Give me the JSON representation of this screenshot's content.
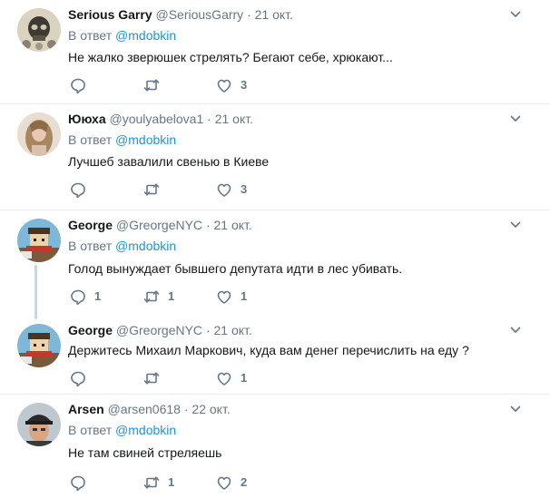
{
  "tweets": [
    {
      "name": "Serious Garry",
      "handle": "@SeriousGarry",
      "dot": "·",
      "time": "21 окт.",
      "reply_prefix": "В ответ ",
      "reply_mention": "@mdobkin",
      "text": "Не жалко зверюшек стрелять? Бегают себе, хрюкают...",
      "replies": "",
      "retweets": "",
      "likes": "3",
      "avatar_icon": "skull-avatar"
    },
    {
      "name": "Ююха",
      "handle": "@youlyabelova1",
      "dot": "·",
      "time": "21 окт.",
      "reply_prefix": "В ответ ",
      "reply_mention": "@mdobkin",
      "text": "Лучшеб завалили свенью в Киеве",
      "replies": "",
      "retweets": "",
      "likes": "3",
      "avatar_icon": "woman-avatar"
    },
    {
      "name": "George",
      "handle": "@GreorgeNYC",
      "dot": "·",
      "time": "21 окт.",
      "reply_prefix": "В ответ ",
      "reply_mention": "@mdobkin",
      "text": "Голод вынуждает бывшего депутата идти в лес убивать.",
      "replies": "1",
      "retweets": "1",
      "likes": "1",
      "avatar_icon": "cartoon-avatar"
    },
    {
      "name": "George",
      "handle": "@GreorgeNYC",
      "dot": "·",
      "time": "21 окт.",
      "text": "Держитесь Михаил Маркович, куда вам денег перечислить на еду ?",
      "replies": "",
      "retweets": "",
      "likes": "1",
      "avatar_icon": "cartoon-avatar"
    },
    {
      "name": "Arsen",
      "handle": "@arsen0618",
      "dot": "·",
      "time": "22 окт.",
      "reply_prefix": "В ответ ",
      "reply_mention": "@mdobkin",
      "text": "Не там свиней стреляешь",
      "replies": "",
      "retweets": "1",
      "likes": "2",
      "avatar_icon": "man-cap-avatar"
    }
  ],
  "colors": {
    "name": "#14171a",
    "secondary": "#657786",
    "link": "#1b95e0",
    "divider": "#e6ecf0",
    "thread_line": "#ccd6dd",
    "icon": "#657786"
  },
  "icons": {
    "reply": "reply-icon",
    "retweet": "retweet-icon",
    "like": "heart-icon",
    "menu": "chevron-down-icon"
  }
}
